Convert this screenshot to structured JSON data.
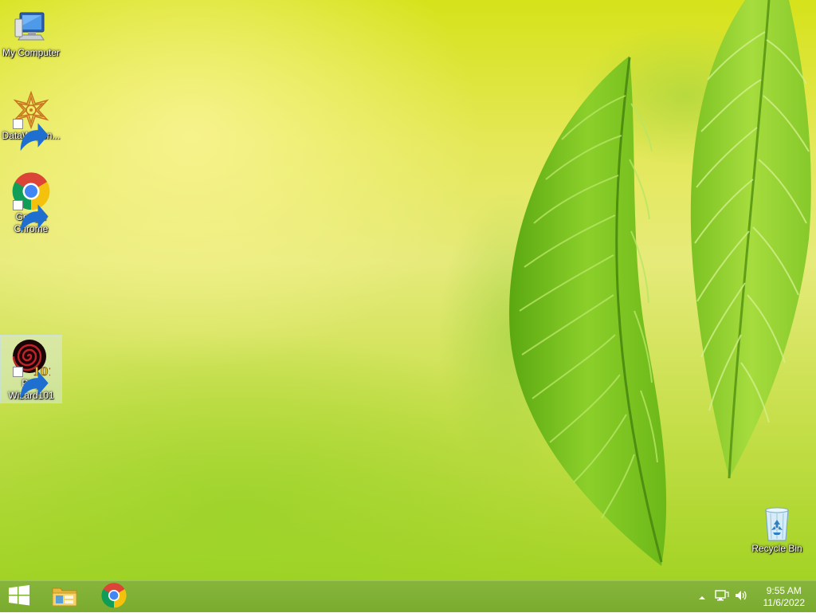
{
  "desktop": {
    "icons": [
      {
        "label": "My Computer",
        "icon": "computer-icon",
        "shortcut": false,
        "selected": false
      },
      {
        "label": "DataWagon...",
        "icon": "datawagon-icon",
        "shortcut": true,
        "selected": false
      },
      {
        "label": "Google Chrome",
        "icon": "chrome-icon",
        "shortcut": true,
        "selected": false
      },
      {
        "label": "Play Wizard101",
        "icon": "wizard101-icon",
        "shortcut": true,
        "selected": true
      },
      {
        "label": "Recycle Bin",
        "icon": "recycle-bin-icon",
        "shortcut": false,
        "selected": false
      }
    ]
  },
  "taskbar": {
    "start": {
      "icon": "windows-logo-icon"
    },
    "pinned": [
      {
        "app": "File Explorer",
        "icon": "file-explorer-icon"
      },
      {
        "app": "Google Chrome",
        "icon": "chrome-icon"
      }
    ],
    "tray": {
      "icons": [
        "show-hidden-icons-icon",
        "network-icon",
        "volume-icon"
      ]
    },
    "clock": {
      "time": "9:55 AM",
      "date": "11/6/2022"
    }
  },
  "colors": {
    "taskbar": "#7aab2f",
    "wallpaper_top": "#d6e21a",
    "wallpaper_bottom": "#a3d324",
    "leaf": "#7cc41e"
  }
}
